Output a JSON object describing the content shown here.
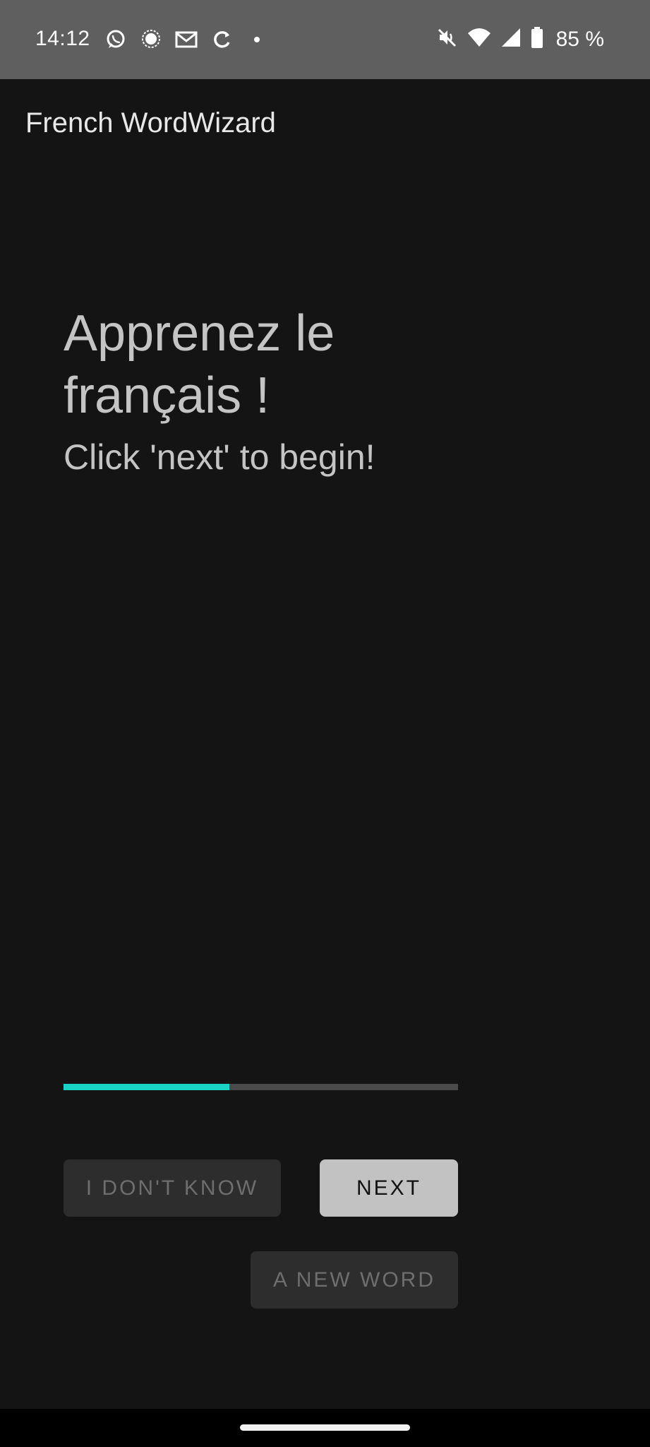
{
  "status_bar": {
    "time": "14:12",
    "battery_percent": "85 %",
    "left_icons": [
      "whatsapp-icon",
      "chat-bubble-icon",
      "mail-icon",
      "sync-icon",
      "notification-dot-icon"
    ],
    "right_icons": [
      "muted-speaker-icon",
      "wifi-icon",
      "cell-signal-icon",
      "battery-icon"
    ]
  },
  "app_bar": {
    "title": "French WordWizard"
  },
  "main": {
    "headline": "Apprenez le français !",
    "subline": "Click 'next' to begin!"
  },
  "progress": {
    "fraction": 0.42,
    "fill_color": "#19d3c5",
    "track_color": "#4a4a4a"
  },
  "buttons": {
    "dont_know": "I DON'T KNOW",
    "next": "NEXT",
    "new_word": "A NEW WORD"
  },
  "colors": {
    "background": "#141414",
    "status_bar": "#5f5f5f"
  }
}
